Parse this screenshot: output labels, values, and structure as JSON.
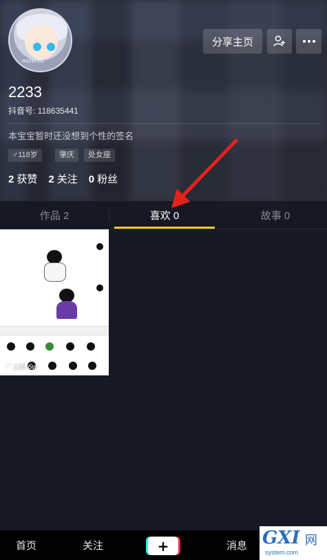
{
  "profile": {
    "username": "2233",
    "douyin_id": "抖音号: 118635441",
    "signature": "本宝宝暂时还没想到个性的签名",
    "tags": [
      "♂118岁",
      "肇庆",
      "处女座"
    ],
    "avatar_text": "miHoYo"
  },
  "actions": {
    "share_label": "分享主页",
    "add_friend_icon": "add-user-icon",
    "more_icon": "more-icon"
  },
  "stats": [
    {
      "num": "2",
      "label": "获赞"
    },
    {
      "num": "2",
      "label": "关注"
    },
    {
      "num": "0",
      "label": "粉丝"
    }
  ],
  "tabs": [
    {
      "label": "作品 2"
    },
    {
      "label": "喜欢 0"
    },
    {
      "label": "故事 0"
    }
  ],
  "liked_video": {
    "like_count": "135.6w"
  },
  "bottom_nav": {
    "home": "首页",
    "follow": "关注",
    "plus": "+",
    "message": "消息"
  },
  "watermark": {
    "logo": "GXI",
    "wang": "网",
    "domain": "system.com"
  },
  "colors": {
    "background": "#161823",
    "tab_underline": "#face15",
    "annotation_arrow": "#e8201c"
  }
}
